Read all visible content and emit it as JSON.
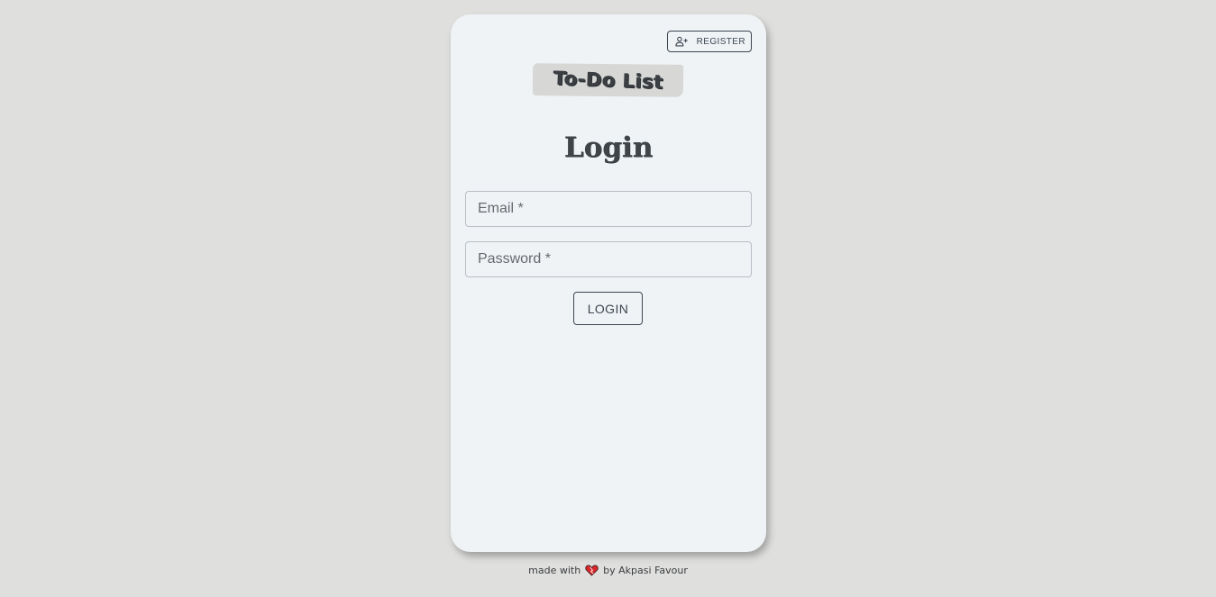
{
  "header": {
    "register_label": "REGISTER",
    "register_icon": "person-add-icon"
  },
  "logo": {
    "text": "To-Do List"
  },
  "form": {
    "title": "Login",
    "email_placeholder": "Email *",
    "email_value": "",
    "password_placeholder": "Password *",
    "password_value": "",
    "submit_label": "LOGIN"
  },
  "footer": {
    "made_with": "made with",
    "heart_icon": "heart-icon",
    "by_text": "by Akpasi Favour"
  },
  "colors": {
    "page_bg": "#dfdfdd",
    "card_bg": "#eff3f6",
    "accent": "#3d4550",
    "heart": "#d9262b"
  }
}
